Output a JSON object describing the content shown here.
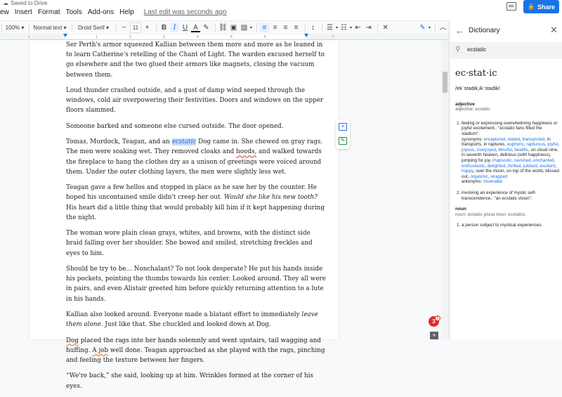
{
  "header": {
    "saved_status": "Saved to Drive",
    "menu": [
      "ew",
      "Insert",
      "Format",
      "Tools",
      "Add-ons",
      "Help"
    ],
    "last_edit": "Last edit was seconds ago",
    "share_label": "Share"
  },
  "toolbar": {
    "zoom": "100%",
    "style": "Normal text",
    "font": "Droid Serif",
    "font_size": "11",
    "bold": "B",
    "italic": "I",
    "underline": "U",
    "text_color": "A"
  },
  "ruler": {
    "numbers": [
      "1",
      "1",
      "2",
      "3",
      "4",
      "5",
      "6",
      "7"
    ]
  },
  "document": {
    "paragraphs": [
      {
        "id": "p1",
        "text": "Ser Perth's armor squeezed Kallian between them more and more as he leaned in to learn Catherine's retelling of the Chant of Light. The warden excused herself to go elsewhere and the two glued their armors like magnets, closing the vacuum between them."
      },
      {
        "id": "p2",
        "text": "Loud thunder crashed outside, and a gust of damp wind seeped through the windows, cold air overpowering their festivities. Doors and windows on the upper floors slammed."
      },
      {
        "id": "p3",
        "text": "Someone barked and someone else cursed outside. The door opened."
      },
      {
        "id": "p4a",
        "text": "Tomas, Murdock, Teagan, and an "
      },
      {
        "id": "p4b",
        "text": "ecstatic"
      },
      {
        "id": "p4c",
        "text": " Dog came in. She chewed on gray rags. The men were soaking wet. They removed cloaks and "
      },
      {
        "id": "p4d",
        "text": "hoods,"
      },
      {
        "id": "p4e",
        "text": " and walked towards the fireplace to hang the clothes dry as a unison of greetings were voiced around them. Under the outer clothing layers, the men were slightly less wet."
      },
      {
        "id": "p5a",
        "text": "Teagan gave a few hellos and stopped in place as he saw her by the counter. He hoped his uncontained smile didn't creep her out. "
      },
      {
        "id": "p5b",
        "text": "Would she like his new tooth?"
      },
      {
        "id": "p5c",
        "text": " His heart did a little thing that would probably kill him if it kept happening during the night."
      },
      {
        "id": "p6",
        "text": "The woman wore plain clean grays, whites, and browns, with the distinct side braid falling over her shoulder. She bowed and smiled, stretching freckles and eyes to him."
      },
      {
        "id": "p7",
        "text": "Should he try to be... Nonchalant? To not look desperate? He put his hands inside his pockets, pointing the thumbs towards his center. Looked around. They all were in pairs, and even Alistair greeted him before quickly returning attention to a lute in his hands."
      },
      {
        "id": "p8a",
        "text": "Kallian also looked around. Everyone made a blatant effort to immediately "
      },
      {
        "id": "p8b",
        "text": "leave them alone."
      },
      {
        "id": "p8c",
        "text": " Just like that. She chuckled and looked down at Dog."
      },
      {
        "id": "p9a",
        "text": "Dog"
      },
      {
        "id": "p9b",
        "text": " placed the rags into her hands solemnly and went upstairs, tail wagging and huffing. "
      },
      {
        "id": "p9c",
        "text": "A job"
      },
      {
        "id": "p9d",
        "text": " well done. Teagan approached as she played with the rags, pinching and feeling the texture between her fingers."
      },
      {
        "id": "p10",
        "text": "“We're back,” she said, looking up at him. Wrinkles formed at the corner of his eyes."
      }
    ]
  },
  "notifications": {
    "count": "3",
    "sub": "0"
  },
  "dictionary": {
    "title": "Dictionary",
    "query": "ecstatic",
    "headword": "ec·stat·ic",
    "pronunciation": "/ekˈstadik,ikˈstadik/",
    "sections": [
      {
        "pos": "adjective",
        "forms": "adjective: ecstatic",
        "defs": [
          {
            "text": "feeling or expressing overwhelming happiness or joyful excitement.: \"ecstatic fans filled the stadium\".",
            "synonyms_label": "synonyms:",
            "synonyms": [
              "enraptured",
              "elated",
              "transported",
              "in transports, in raptures",
              "euphoric",
              "rapturous",
              "joyful",
              "joyous",
              "overjoyed",
              "blissful",
              "beatific",
              "on cloud nine, in seventh heaven, delirious (with happiness), jumping for joy",
              "rhapsodic",
              "ravished",
              "enchanted",
              "enthusiastic",
              "delighted",
              "thrilled",
              "jubilant",
              "exultant",
              "happy",
              "over the moon, on top of the world, blissed out",
              "orgasmic",
              "wrapped"
            ],
            "antonyms_label": "antonyms:",
            "antonyms": [
              "miserable"
            ]
          },
          {
            "text": "involving an experience of mystic self-transcendence.: \"an ecstatic vision\"."
          }
        ]
      },
      {
        "pos": "noun",
        "forms": "noun: ecstatic plural noun: ecstatics",
        "defs": [
          {
            "text": "a person subject to mystical experiences."
          }
        ]
      }
    ]
  }
}
